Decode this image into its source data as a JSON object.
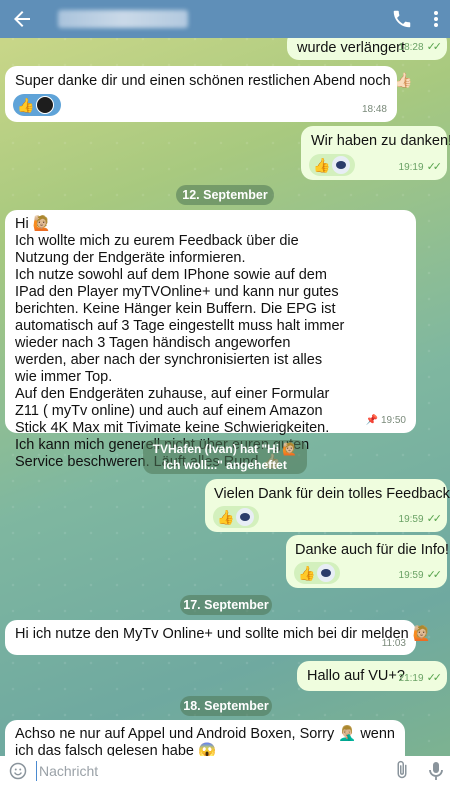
{
  "header": {
    "back_label": "←"
  },
  "messages": [
    {
      "id": "m0",
      "direction": "out",
      "text": "wurde verlängert",
      "time": "18:28",
      "read": true
    },
    {
      "id": "m1",
      "direction": "in",
      "text": "Super danke dir und einen schönen restlichen Abend noch 👍🏻",
      "time": "18:48",
      "reactions": [
        "👍"
      ]
    },
    {
      "id": "m2",
      "direction": "out",
      "text": "Wir haben zu danken!",
      "time": "19:19",
      "read": true,
      "reactions": [
        "👍"
      ]
    },
    {
      "id": "m3",
      "direction": "in",
      "text": "Hi 🙋🏼\nIch wollte mich zu eurem Feedback über die Nutzung der Endgeräte informieren.\nIch nutze sowohl auf dem IPhone sowie auf dem IPad den Player myTVOnline+ und kann nur gutes berichten. Keine Hänger kein Buffern. Die EPG ist automatisch auf 3 Tage eingestellt muss halt immer wieder nach 3 Tagen händisch angeworfen werden, aber nach der synchronisierten ist alles wie immer Top.\nAuf den Endgeräten zuhause, auf einer Formular Z11 ( myTv online) und auch auf einem Amazon Stick 4K Max mit Tivimate keine Schwierigkeiten.\nIch kann mich generell nicht über euren guten Service beschweren. Läuft alles Rund 👍🏻",
      "time": "19:50",
      "pinned": true
    },
    {
      "id": "m4",
      "direction": "out",
      "text": "Vielen Dank für dein tolles Feedback!",
      "time": "19:59",
      "read": true,
      "reactions": [
        "👍"
      ]
    },
    {
      "id": "m5",
      "direction": "out",
      "text": "Danke auch für die Info!",
      "time": "19:59",
      "read": true,
      "reactions": [
        "👍"
      ]
    },
    {
      "id": "m6",
      "direction": "in",
      "text": "Hi ich nutze den MyTv Online+ und sollte mich bei dir melden 🙋🏼",
      "time": "11:03"
    },
    {
      "id": "m7",
      "direction": "out",
      "text": "Hallo auf VU+?",
      "time": "21:19",
      "read": true
    },
    {
      "id": "m8",
      "direction": "in",
      "text": "Achso ne nur auf Appel und Android Boxen, Sorry 🤦🏼‍♂️ wenn ich das falsch gelesen habe 😱",
      "time": ""
    }
  ],
  "dates": {
    "d1": "12. September",
    "d2": "17. September",
    "d3": "18. September"
  },
  "service": {
    "line1": "TVHafen (Ivan) hat \"Hi 🙋🏼",
    "line2": "Ich woll...\" angeheftet"
  },
  "ticks": "✓✓",
  "composer": {
    "placeholder": "Nachricht"
  },
  "colors": {
    "header": "#5f8fb8",
    "incoming": "#ffffff",
    "outgoing": "#effdde",
    "accent": "#58a44d"
  },
  "icons": [
    "back-arrow-icon",
    "phone-icon",
    "more-vertical-icon",
    "emoji-icon",
    "attach-icon",
    "mic-icon",
    "pin-icon"
  ]
}
